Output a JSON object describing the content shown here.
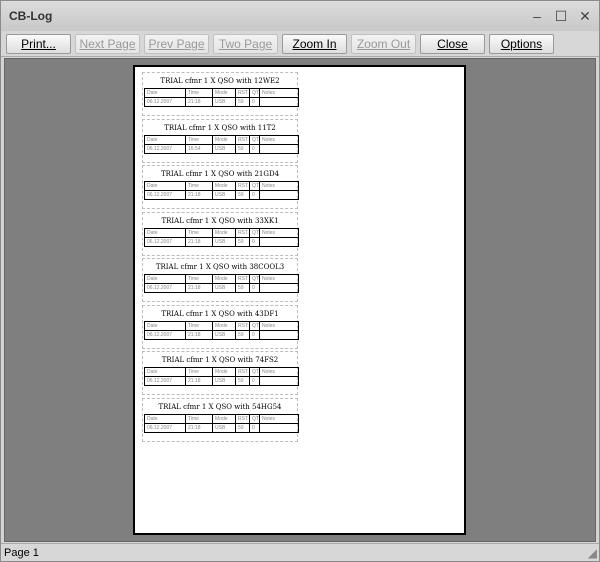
{
  "window": {
    "title": "CB-Log"
  },
  "window_controls": {
    "minimize": "–",
    "maximize": "☐",
    "close": "✕"
  },
  "toolbar": {
    "print": "Print...",
    "next_page": "Next Page",
    "prev_page": "Prev Page",
    "two_page": "Two Page",
    "zoom_in": "Zoom In",
    "zoom_out": "Zoom Out",
    "close": "Close",
    "options": "Options"
  },
  "preview": {
    "columns": [
      "Date",
      "Time",
      "Mode",
      "RST",
      "QTH",
      "Notes"
    ],
    "cards": [
      {
        "title": "TRIAL cfmr 1 X QSO with 12WE2",
        "date": "06.12.2007",
        "time": "21:18",
        "mode": "USB",
        "rst": "59",
        "qth": "0"
      },
      {
        "title": "TRIAL cfmr 1 X QSO with 11T2",
        "date": "06.12.2007",
        "time": "16:54",
        "mode": "USB",
        "rst": "59",
        "qth": "0"
      },
      {
        "title": "TRIAL cfmr 1 X QSO with 21GD4",
        "date": "06.12.2007",
        "time": "21:18",
        "mode": "USB",
        "rst": "59",
        "qth": "0"
      },
      {
        "title": "TRIAL cfmr 1 X QSO with 33XK1",
        "date": "06.12.2007",
        "time": "21:18",
        "mode": "USB",
        "rst": "59",
        "qth": "0"
      },
      {
        "title": "TRIAL cfmr 1 X QSO with 38COOL3",
        "date": "06.12.2007",
        "time": "21:18",
        "mode": "USB",
        "rst": "59",
        "qth": "0"
      },
      {
        "title": "TRIAL cfmr 1 X QSO with 43DF1",
        "date": "06.12.2007",
        "time": "21:18",
        "mode": "USB",
        "rst": "59",
        "qth": "0"
      },
      {
        "title": "TRIAL cfmr 1 X QSO with 74FS2",
        "date": "06.12.2007",
        "time": "21:18",
        "mode": "USB",
        "rst": "59",
        "qth": "0"
      },
      {
        "title": "TRIAL cfmr 1 X QSO with 54HG54",
        "date": "06.12.2007",
        "time": "21:18",
        "mode": "USB",
        "rst": "59",
        "qth": "0"
      }
    ]
  },
  "status": {
    "page": "Page 1"
  }
}
